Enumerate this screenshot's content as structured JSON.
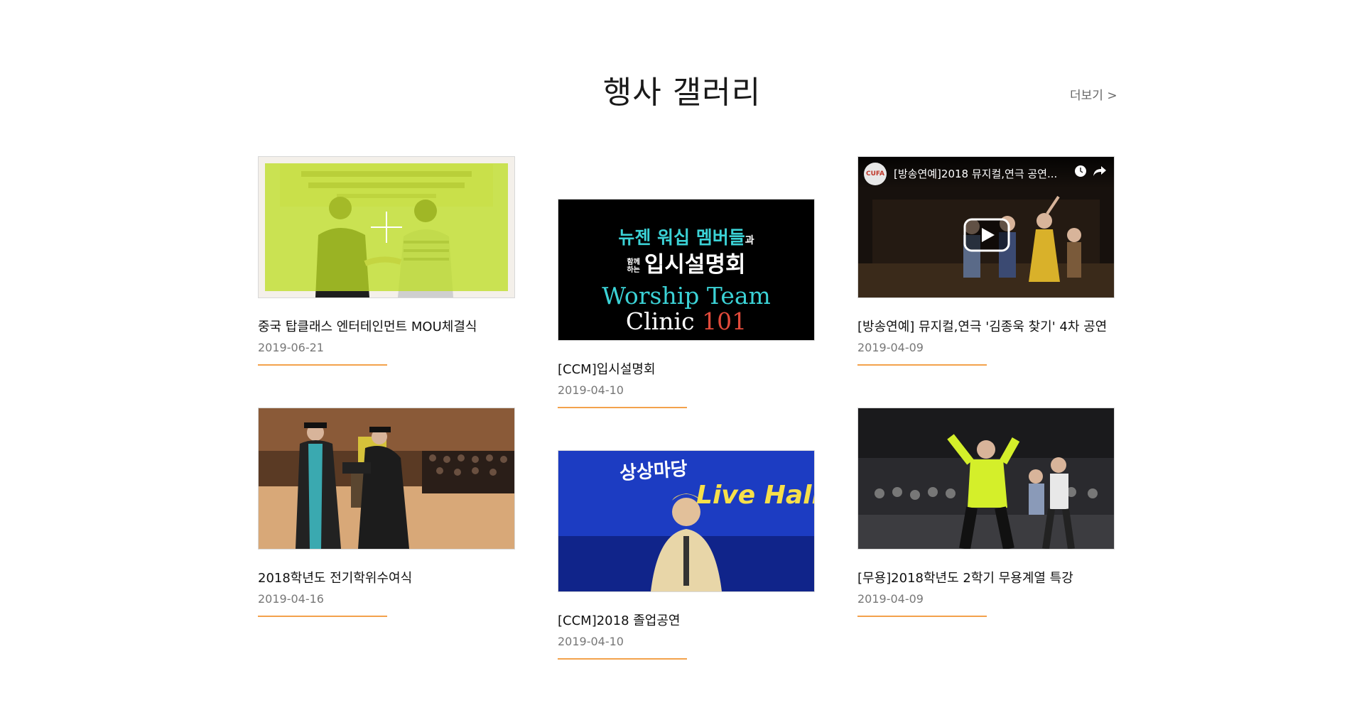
{
  "section": {
    "title": "행사 갤러리",
    "more_label": "더보기 >"
  },
  "colors": {
    "accent_line": "#f3a24c",
    "hover_overlay": "#bede26",
    "teal_text": "#3bd2d6",
    "yellow_text": "#f7e04a"
  },
  "cards": [
    {
      "title": "중국 탑클래스 엔터테인먼트 MOU체결식",
      "date": "2019-06-21",
      "thumb_icon": "plus-icon"
    },
    {
      "title": "[CCM]입시설명회",
      "date": "2019-04-10",
      "thumb": {
        "line1": "뉴젠 워십 멤버들",
        "line1_suffix": "과",
        "line2_small_a": "함께",
        "line2_small_b": "하는",
        "line2": "입시설명회",
        "line3": "Worship Team",
        "line4_word": "Clinic",
        "line4_num": "101"
      }
    },
    {
      "title": "[방송연예]   뮤지컬,연극 '김종욱 찾기' 4차 공연",
      "date": "2019-04-09",
      "video": {
        "channel_logo": "CUFA",
        "title": "[방송연예]2018 뮤지컬,연극 공연...",
        "icons": [
          "clock-icon",
          "share-icon",
          "play-icon"
        ]
      }
    },
    {
      "title": "2018학년도 전기학위수여식",
      "date": "2019-04-16"
    },
    {
      "title": "[CCM]2018 졸업공연",
      "date": "2019-04-10",
      "thumb": {
        "logo": "상상마당",
        "sign": "Live Hall"
      }
    },
    {
      "title": "[무용]2018학년도 2학기 무용계열 특강",
      "date": "2019-04-09"
    }
  ]
}
